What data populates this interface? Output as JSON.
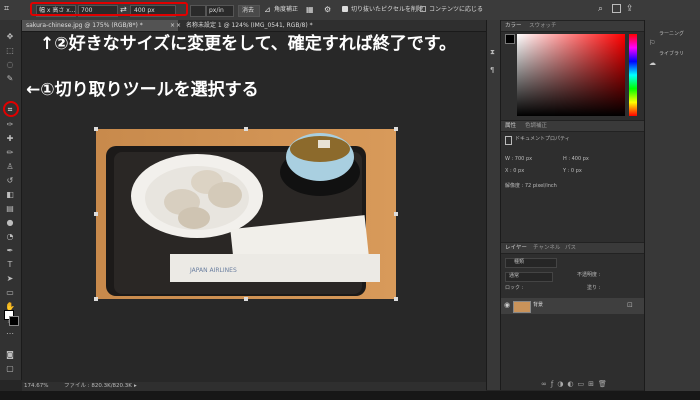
{
  "options_bar": {
    "ratio_preset": "幅 x 高さ x...",
    "width_value": "700",
    "height_value": "400 px",
    "resolution_unit": "px/in",
    "clear_button": "消去",
    "straighten_button": "角度補正",
    "delete_cropped_label": "切り抜いたピクセルを削除",
    "content_aware_label": "コンテンツに応じる"
  },
  "tabs": [
    {
      "label": "sakura-chinese.jpg @ 175% (RGB/8*) *"
    },
    {
      "label": "名称未設定 1 @ 124% (IMG_0541, RGB/8) *"
    }
  ],
  "status_bar": {
    "zoom": "174.67%",
    "file_info": "ファイル : 820.3K/820.3K"
  },
  "right_panel": {
    "color_tabs": [
      "カラー",
      "スウォッチ"
    ],
    "properties_tabs": [
      "属性",
      "色調補正"
    ],
    "doc_properties_label": "ドキュメントプロパティ",
    "w_label": "W : 700 px",
    "h_label": "H : 400 px",
    "x_label": "X : 0 px",
    "y_label": "Y : 0 px",
    "resolution_label": "解像度 : 72 pixel/inch",
    "layers_tabs": [
      "レイヤー",
      "チャンネル",
      "パス"
    ],
    "layer_filter": "種類",
    "blend_mode": "通常",
    "opacity_label": "不透明度 :",
    "lock_label": "ロック :",
    "fill_label": "塗り :",
    "layer_name": "背景"
  },
  "far_right": {
    "items": [
      "ラーニング",
      "ライブラリ"
    ]
  },
  "annotations": {
    "step2": "↑②好きなサイズに変更をして、確定すれば終了です。",
    "step1": "←①切り取りツールを選択する"
  },
  "photo": {
    "tray_label": "JAPAN AIRLINES"
  },
  "colors": {
    "highlight": "#e00000",
    "annotation_text": "#ffffff"
  }
}
